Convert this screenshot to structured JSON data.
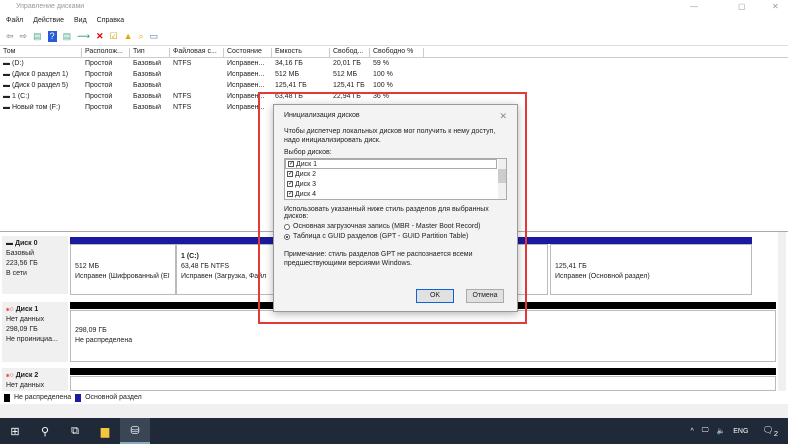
{
  "window": {
    "title": "Управление дисками"
  },
  "menu": [
    "Файл",
    "Действие",
    "Вид",
    "Справка"
  ],
  "table": {
    "headers": [
      "Том",
      "Располож...",
      "Тип",
      "Файловая с...",
      "Состояние",
      "Емкость",
      "Свобод...",
      "Свободно %"
    ],
    "rows": [
      [
        "(D:)",
        "Простой",
        "Базовый",
        "NTFS",
        "Исправен...",
        "34,16 ГБ",
        "20,01 ГБ",
        "59 %"
      ],
      [
        "(Диск 0 раздел 1)",
        "Простой",
        "Базовый",
        "",
        "Исправен...",
        "512 МБ",
        "512 МБ",
        "100 %"
      ],
      [
        "(Диск 0 раздел 5)",
        "Простой",
        "Базовый",
        "",
        "Исправен...",
        "125,41 ГБ",
        "125,41 ГБ",
        "100 %"
      ],
      [
        "1 (C:)",
        "Простой",
        "Базовый",
        "NTFS",
        "Исправен...",
        "63,48 ГБ",
        "22,94 ГБ",
        "36 %"
      ],
      [
        "Новый том (F:)",
        "Простой",
        "Базовый",
        "NTFS",
        "Исправен...",
        "",
        "",
        ""
      ]
    ]
  },
  "disks": [
    {
      "name": "Диск 0",
      "type": "Базовый",
      "size": "223,56 ГБ",
      "status": "В сети",
      "parts": [
        {
          "l1": "512 МБ",
          "l2": "Исправен (Шифрованный (EI"
        },
        {
          "title": "1  (C:)",
          "l1": "63,48 ГБ NTFS",
          "l2": "Исправен (Загрузка, Файл"
        },
        {
          "l1": "125,41 ГБ",
          "l2": "Исправен (Основной раздел)"
        }
      ]
    },
    {
      "name": "Диск 1",
      "type": "Нет данных",
      "size": "298,09 ГБ",
      "status": "Не проинициа...",
      "parts": [
        {
          "l1": "298,09 ГБ",
          "l2": "Не распределена"
        }
      ]
    },
    {
      "name": "Диск 2",
      "type": "Нет данных"
    }
  ],
  "legend": [
    "Не распределена",
    "Основной раздел"
  ],
  "colors": {
    "unallocated": "#000000",
    "primary": "#1a1aa0",
    "highlight": "#e53935"
  },
  "dialog": {
    "title": "Инициализация дисков",
    "intro": "Чтобы диспетчер локальных дисков мог получить к нему доступ, надо инициализировать диск.",
    "select_label": "Выбор дисков:",
    "disks": [
      "Диск 1",
      "Диск 2",
      "Диск 3",
      "Диск 4"
    ],
    "style_label": "Использовать указанный ниже стиль разделов для выбранных дисков:",
    "mbr": "Основная загрузочная запись (MBR - Master Boot Record)",
    "gpt": "Таблица с GUID разделов (GPT - GUID Partition Table)",
    "note": "Примечание: стиль разделов GPT не распознается всеми предшествующими версиями Windows.",
    "ok": "OK",
    "cancel": "Отмена"
  },
  "taskbar": {
    "lang": "ENG",
    "notifications": "2"
  }
}
